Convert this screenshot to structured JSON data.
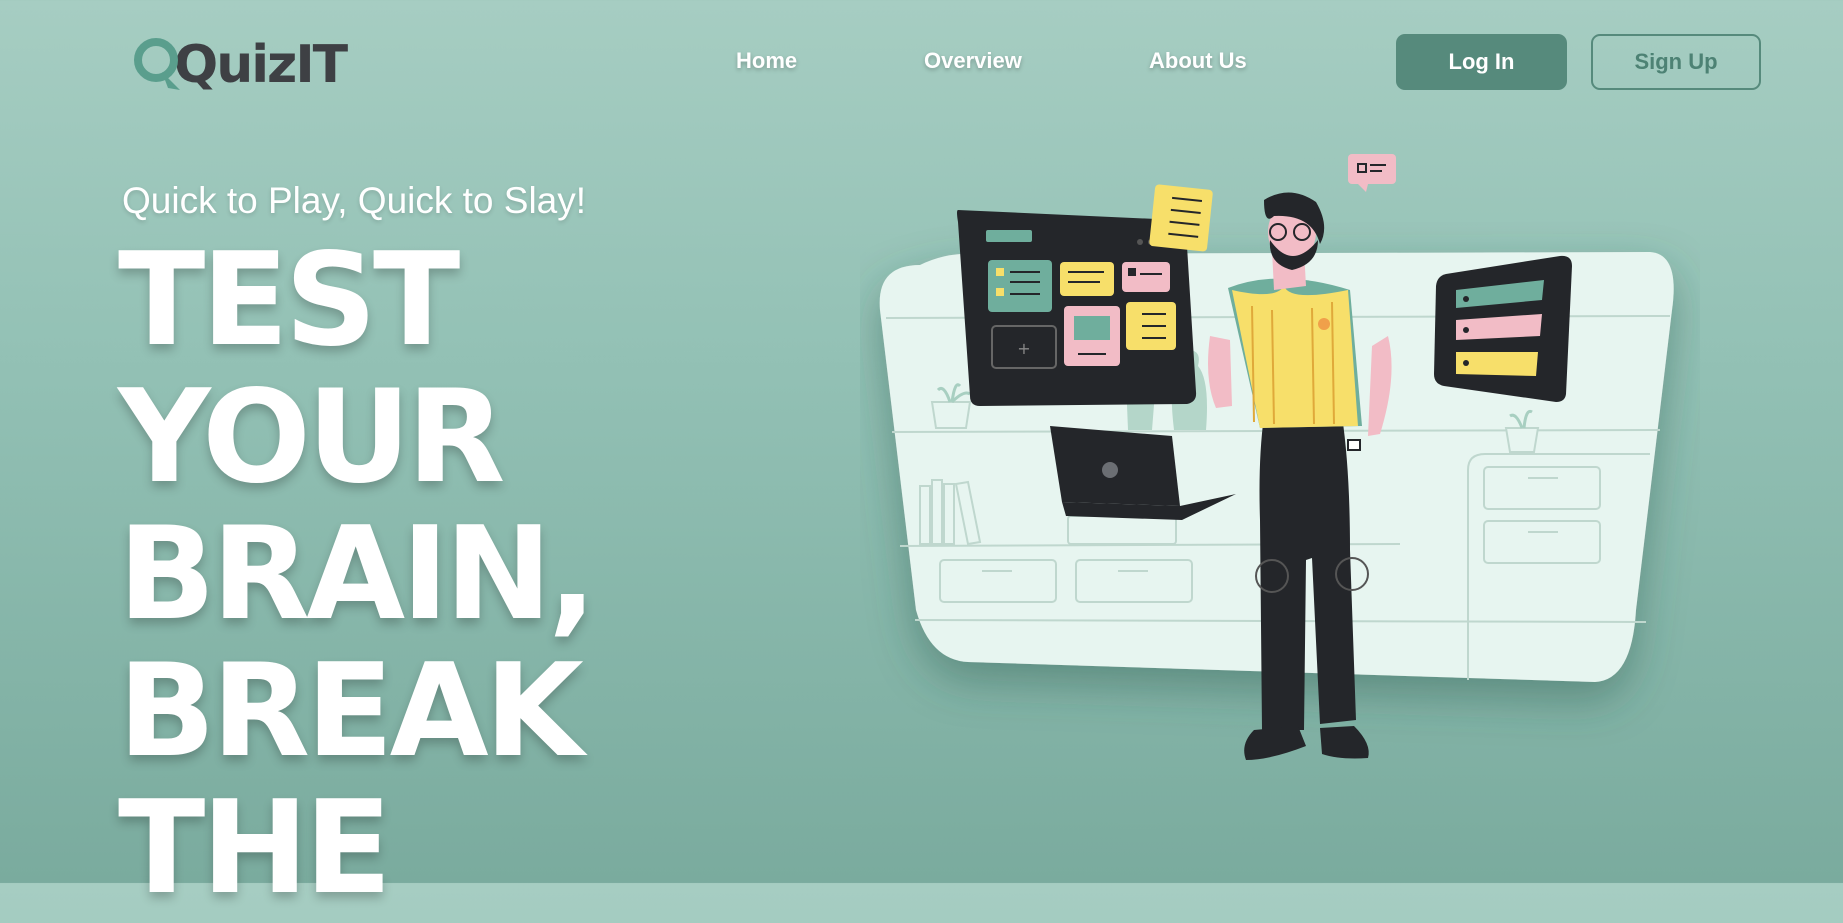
{
  "brand": {
    "name": "QuizIT",
    "logo_icon": "magnifier-q-icon",
    "accent": "#5a9e8d"
  },
  "nav": {
    "links": [
      "Home",
      "Overview",
      "About Us"
    ],
    "login_label": "Log In",
    "signup_label": "Sign Up"
  },
  "hero": {
    "tagline": "Quick to Play, Quick to Slay!",
    "headline_lines": [
      "TEST",
      "YOUR",
      "BRAIN,",
      "BREAK",
      "THE"
    ]
  },
  "illustration": {
    "subject": "person-with-floating-screens-illustration"
  },
  "colors": {
    "bg_top": "#a6cdc2",
    "bg_bottom": "#7aab9e",
    "button_primary": "#568a7c",
    "dark": "#24262a",
    "yellow": "#f7df6a",
    "pink": "#f2bcc6",
    "teal": "#6fae9d"
  }
}
